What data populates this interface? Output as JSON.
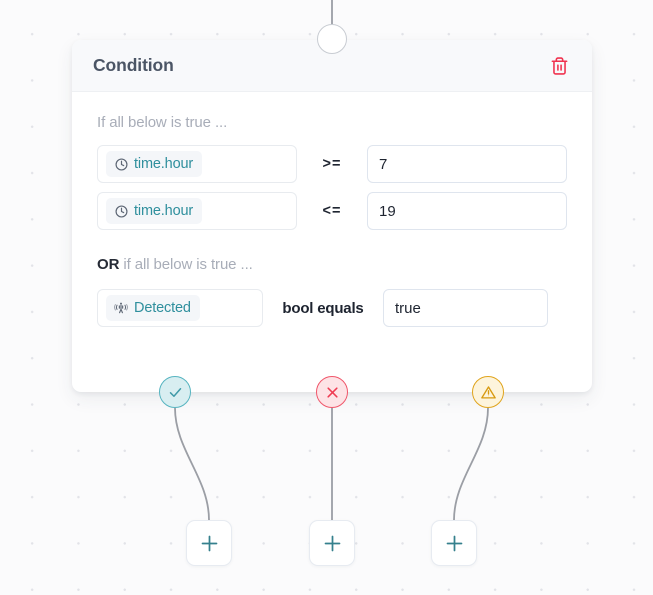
{
  "canvas": {
    "background_color": "#fbfbfc",
    "dot_color": "#e2e3e8",
    "wire_color": "#9b9ea5"
  },
  "top_connector": {
    "name": "input-connector",
    "shape": "circle"
  },
  "card": {
    "title": "Condition",
    "delete_icon": "trash-icon",
    "delete_color": "#f0334f",
    "groups": [
      {
        "id": "and-group",
        "label": "If all below is true ...",
        "rows": [
          {
            "entity_icon": "clock-icon",
            "entity_label": "time.hour",
            "operator": ">=",
            "value": "7"
          },
          {
            "entity_icon": "clock-icon",
            "entity_label": "time.hour",
            "operator": "<=",
            "value": "19"
          }
        ]
      },
      {
        "id": "or-group",
        "label_keyword": "OR",
        "label_rest": " if all below is true ...",
        "rows": [
          {
            "entity_icon": "motion-sensor-icon",
            "entity_label": "Detected",
            "operator": "bool equals",
            "value": "true"
          }
        ]
      }
    ],
    "accent_color": "#2f8f9d"
  },
  "outputs": [
    {
      "id": "output-true",
      "icon": "check-icon",
      "color": "#56b4c0",
      "fill": "#d8eef1"
    },
    {
      "id": "output-false",
      "icon": "close-icon",
      "color": "#f0566a",
      "fill": "#fde3e6"
    },
    {
      "id": "output-error",
      "icon": "warning-icon",
      "color": "#e0a41c",
      "fill": "#fdf4dc"
    }
  ],
  "add_buttons": [
    {
      "id": "add-node-true",
      "icon": "plus-icon",
      "color": "#35808d"
    },
    {
      "id": "add-node-false",
      "icon": "plus-icon",
      "color": "#35808d"
    },
    {
      "id": "add-node-error",
      "icon": "plus-icon",
      "color": "#35808d"
    }
  ]
}
